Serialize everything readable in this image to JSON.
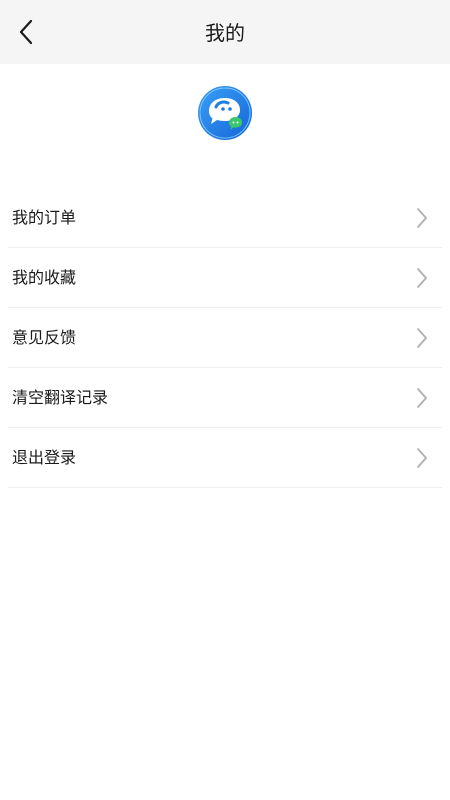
{
  "header": {
    "title": "我的",
    "back_icon": "chevron-left-icon"
  },
  "profile": {
    "avatar_icon": "chat-bubble-app-logo-icon"
  },
  "menu": {
    "items": [
      {
        "label": "我的订单",
        "icon": "chevron-right-icon"
      },
      {
        "label": "我的收藏",
        "icon": "chevron-right-icon"
      },
      {
        "label": "意见反馈",
        "icon": "chevron-right-icon"
      },
      {
        "label": "清空翻译记录",
        "icon": "chevron-right-icon"
      },
      {
        "label": "退出登录",
        "icon": "chevron-right-icon"
      }
    ]
  },
  "colors": {
    "header_bg": "#f5f5f5",
    "avatar_blue": "#1f7fe0",
    "avatar_green": "#3cc86a",
    "chevron": "#b0b0b0",
    "divider": "#eeeeee"
  }
}
